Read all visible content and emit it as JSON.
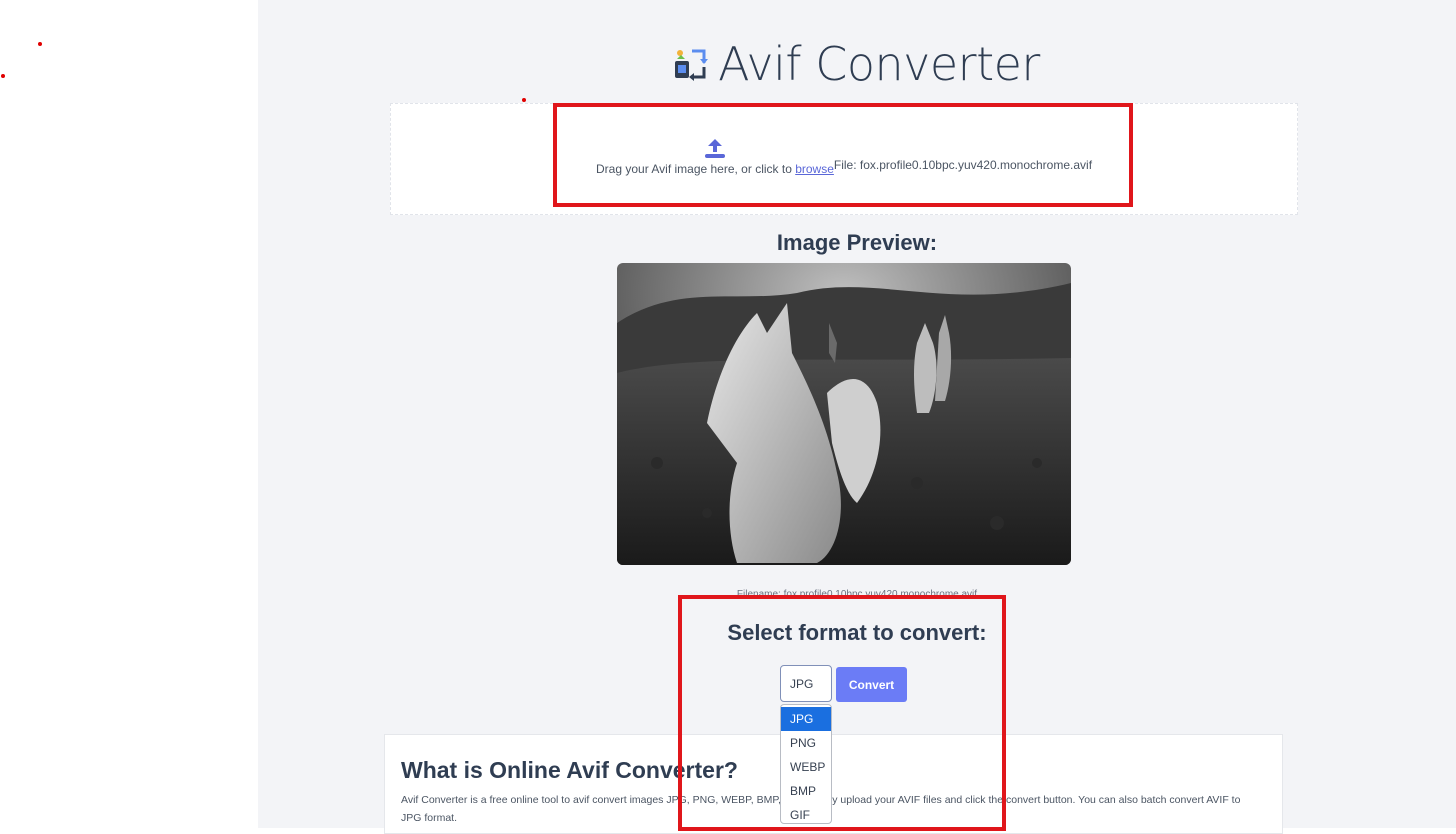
{
  "app": {
    "title": "Avif Converter",
    "accent_color": "#6b7cf6",
    "logo_icon": "image-convert-icon"
  },
  "upload": {
    "icon": "upload-icon",
    "instruction": "Drag your Avif image here, or click to ",
    "browse_link": "browse",
    "file_info": "File: fox.profile0.10bpc.yuv420.monochrome.avif"
  },
  "preview": {
    "heading": "Image Preview:",
    "filename": "Filename: fox.profile0.10bpc.yuv420.monochrome.avif"
  },
  "convert": {
    "heading": "Select format to convert:",
    "selected_format": "JPG",
    "button_label": "Convert",
    "options": [
      "JPG",
      "PNG",
      "WEBP",
      "BMP",
      "GIF"
    ],
    "highlighted_option": "JPG"
  },
  "about": {
    "heading": "What is Online Avif Converter?",
    "body": "Avif Converter is a free online tool to avif convert images JPG, PNG, WEBP, BMP, GIF. Simply upload your AVIF files and click the convert button. You can also batch convert AVIF to JPG format."
  },
  "annotation_color": "#e0161b"
}
